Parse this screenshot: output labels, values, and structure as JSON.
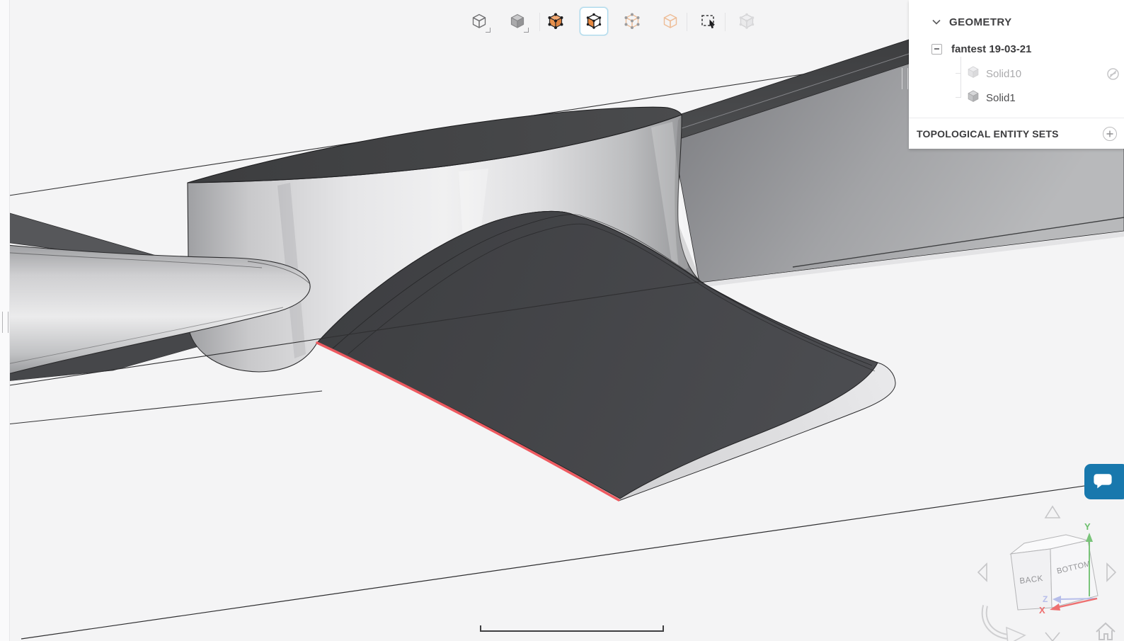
{
  "panel": {
    "geometry_header": "GEOMETRY",
    "tree_root_label": "fantest 19-03-21",
    "solids": [
      {
        "label": "Solid10",
        "hidden": true
      },
      {
        "label": "Solid1",
        "hidden": false
      }
    ],
    "topo_header": "TOPOLOGICAL ENTITY SETS"
  },
  "toolbar": {
    "buttons": [
      {
        "icon": "wireframe-cube-icon",
        "state": "normal"
      },
      {
        "icon": "shaded-cube-icon",
        "state": "normal"
      },
      {
        "icon": "select-volume-highlight-icon",
        "state": "active-orange"
      },
      {
        "icon": "select-face-icon",
        "state": "selected"
      },
      {
        "icon": "select-vertex-icon",
        "state": "faded"
      },
      {
        "icon": "select-edge-icon",
        "state": "faded"
      },
      {
        "icon": "box-select-icon",
        "state": "normal"
      },
      {
        "icon": "select-assembly-icon",
        "state": "disabled"
      }
    ]
  },
  "view_cube": {
    "face_left": "BACK",
    "face_right": "BOTTOM",
    "axes": [
      {
        "label": "Y",
        "color": "#7ac47a"
      },
      {
        "label": "Z",
        "color": "#b6bdea"
      },
      {
        "label": "X",
        "color": "#ee7070"
      }
    ]
  },
  "scene": {
    "geometry_name": "fantest 19-03-21",
    "selected_edge_color": "#ee5a60",
    "background": "#f4f4f5"
  },
  "chat": {
    "icon": "chat-bubble-icon"
  }
}
